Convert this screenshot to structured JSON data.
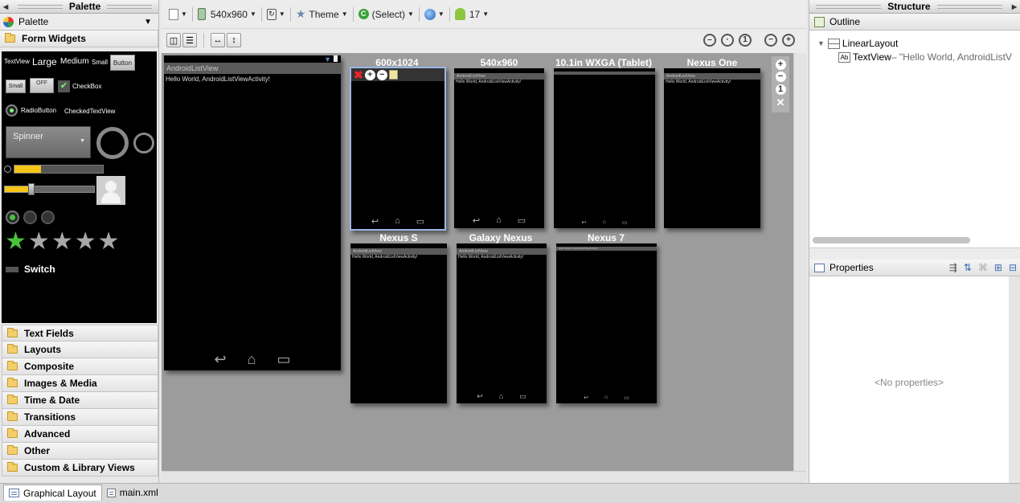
{
  "palette": {
    "title": "Palette",
    "header_label": "Palette",
    "categories_top": "Form Widgets",
    "widgets": {
      "textview": "TextView",
      "large": "Large",
      "medium": "Medium",
      "small": "Small",
      "button": "Button",
      "small_button": "Small",
      "toggle_off": "OFF",
      "checkbox": "CheckBox",
      "radiobutton": "RadioButton",
      "checkedtextview": "CheckedTextView",
      "spinner": "Spinner",
      "switch": "Switch"
    },
    "categories": [
      "Text Fields",
      "Layouts",
      "Composite",
      "Images & Media",
      "Time & Date",
      "Transitions",
      "Advanced",
      "Other",
      "Custom & Library Views"
    ]
  },
  "toolbar": {
    "device": "540x960",
    "theme": "Theme",
    "activity": "(Select)",
    "api": "17"
  },
  "canvas": {
    "app_title": "AndroidListView",
    "hello_text": "Hello World, AndroidListViewActivity!",
    "previews": [
      {
        "label": "600x1024"
      },
      {
        "label": "540x960"
      },
      {
        "label": "10.1in WXGA (Tablet)"
      },
      {
        "label": "Nexus One"
      },
      {
        "label": "Nexus S"
      },
      {
        "label": "Galaxy Nexus"
      },
      {
        "label": "Nexus 7"
      }
    ]
  },
  "structure": {
    "title": "Structure",
    "outline_label": "Outline",
    "tree": {
      "root": "LinearLayout",
      "child_type": "TextView",
      "child_text": " – \"Hello World, AndroidListV"
    },
    "properties_label": "Properties",
    "no_properties": "<No properties>"
  },
  "bottom_tabs": [
    "Graphical Layout",
    "main.xml"
  ],
  "colors": {
    "accent_green": "#48c23a",
    "progress_yellow": "#f5c518",
    "preview_select": "#9ab8e6"
  }
}
